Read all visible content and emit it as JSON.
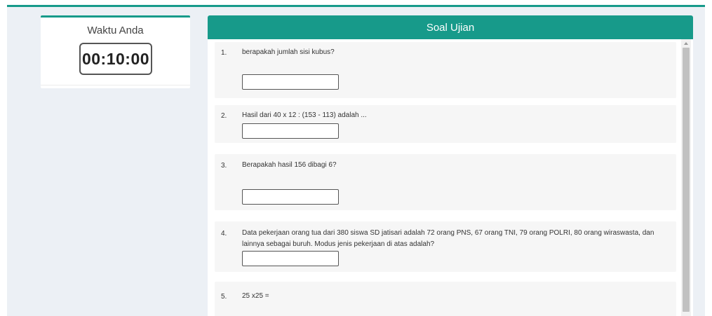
{
  "timer": {
    "title": "Waktu Anda",
    "value": "00:10:00"
  },
  "exam": {
    "title": "Soal Ujian",
    "questions": [
      {
        "number": "1.",
        "text": "berapakah jumlah sisi kubus?",
        "answer": ""
      },
      {
        "number": "2.",
        "text": "Hasil dari 40 x 12 : (153 - 113) adalah ...",
        "answer": ""
      },
      {
        "number": "3.",
        "text": "Berapakah hasil 156 dibagi 6?",
        "answer": ""
      },
      {
        "number": "4.",
        "text": "Data pekerjaan orang tua dari 380 siswa SD jatisari adalah 72 orang PNS, 67 orang TNI, 79 orang POLRI, 80 orang wiraswasta, dan lainnya sebagai buruh. Modus jenis pekerjaan di atas adalah?",
        "answer": ""
      },
      {
        "number": "5.",
        "text": "25 x25 =",
        "answer": ""
      }
    ]
  },
  "colors": {
    "accent": "#179a8a",
    "page_background": "#ecf0f5"
  }
}
